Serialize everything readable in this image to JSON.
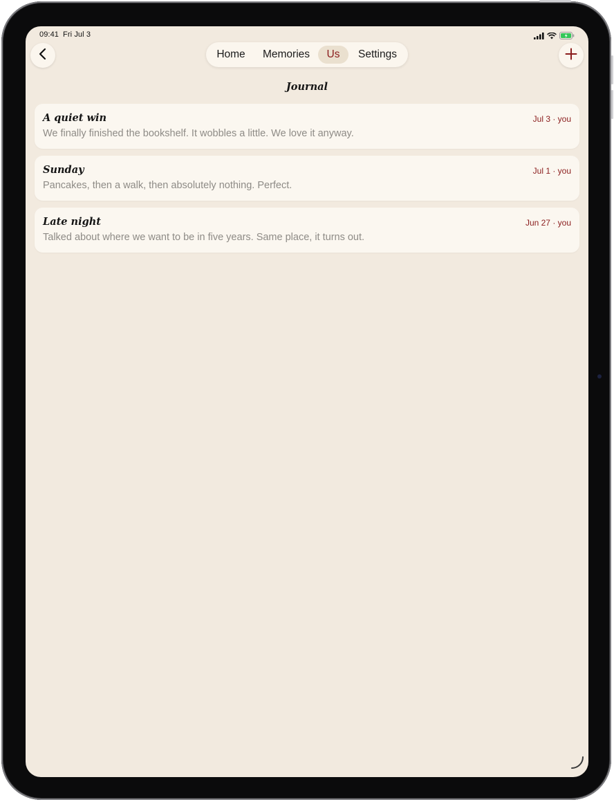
{
  "status_bar": {
    "time": "09:41",
    "date": "Fri Jul 3"
  },
  "toolbar": {
    "back_icon": "chevron-left-icon",
    "add_icon": "plus-icon",
    "tabs": [
      {
        "label": "Home",
        "active": false
      },
      {
        "label": "Memories",
        "active": false
      },
      {
        "label": "Us",
        "active": true
      },
      {
        "label": "Settings",
        "active": false
      }
    ]
  },
  "page": {
    "title": "Journal"
  },
  "entries": [
    {
      "title": "A quiet win",
      "meta": "Jul 3 · you",
      "body": "We finally finished the bookshelf. It wobbles a little. We love it anyway."
    },
    {
      "title": "Sunday",
      "meta": "Jul 1 · you",
      "body": "Pancakes, then a walk, then absolutely nothing. Perfect."
    },
    {
      "title": "Late night",
      "meta": "Jun 27 · you",
      "body": "Talked about where we want to be in five years. Same place, it turns out."
    }
  ],
  "colors": {
    "background": "#f2eadf",
    "card": "#fbf7f0",
    "accent": "#8a1c1c",
    "active_tab_bg": "#eae0cf",
    "muted_text": "#8e8b86",
    "battery": "#34c759"
  }
}
